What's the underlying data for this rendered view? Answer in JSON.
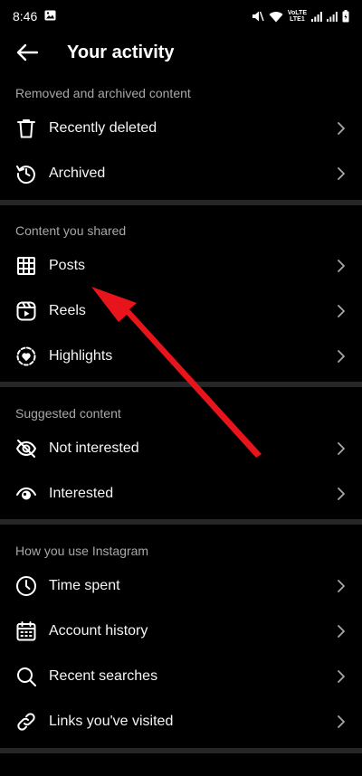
{
  "status": {
    "time": "8:46",
    "volte_top": "VoLTE",
    "volte_bottom": "LTE1"
  },
  "header": {
    "title": "Your activity"
  },
  "sections": {
    "removed": {
      "title": "Removed and archived content",
      "items": [
        "Recently deleted",
        "Archived"
      ]
    },
    "shared": {
      "title": "Content you shared",
      "items": [
        "Posts",
        "Reels",
        "Highlights"
      ]
    },
    "suggested": {
      "title": "Suggested content",
      "items": [
        "Not interested",
        "Interested"
      ]
    },
    "usage": {
      "title": "How you use Instagram",
      "items": [
        "Time spent",
        "Account history",
        "Recent searches",
        "Links you've visited"
      ]
    }
  },
  "colors": {
    "background": "#000000",
    "divider": "#262626",
    "secondary_text": "#a8a8a8",
    "annotation_arrow": "#e8141c"
  }
}
